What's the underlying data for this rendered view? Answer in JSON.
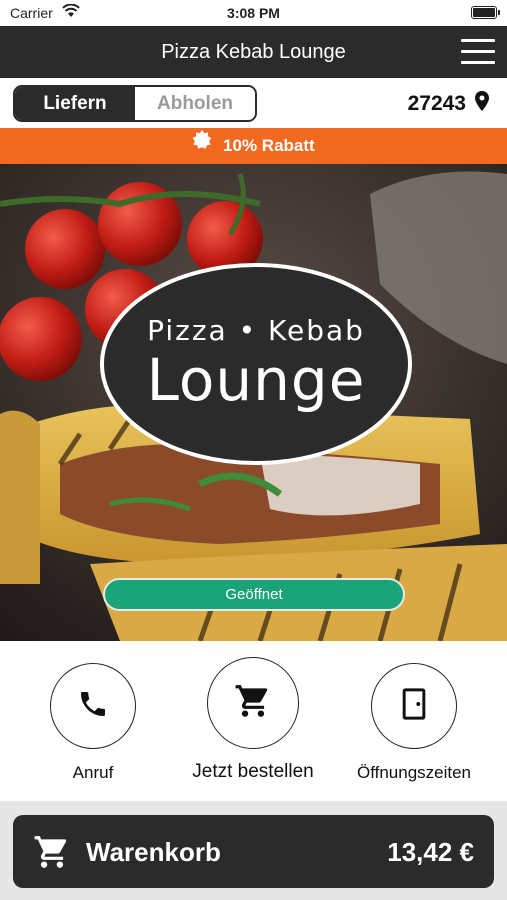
{
  "status_bar": {
    "carrier": "Carrier",
    "time": "3:08 PM"
  },
  "header": {
    "title": "Pizza Kebab Lounge"
  },
  "mode": {
    "delivery": "Liefern",
    "pickup": "Abholen",
    "selected": "Liefern",
    "zip": "27243"
  },
  "promo": {
    "text": "10% Rabatt"
  },
  "hero": {
    "logo_top": "Pizza • Kebab",
    "logo_main": "Lounge",
    "status_button": "Geöffnet"
  },
  "actions": [
    {
      "label": "Anruf",
      "icon": "phone-icon"
    },
    {
      "label": "Jetzt bestellen",
      "icon": "cart-icon"
    },
    {
      "label": "Öffnungszeiten",
      "icon": "door-icon"
    }
  ],
  "cart": {
    "label": "Warenkorb",
    "total": "13,42 €"
  },
  "colors": {
    "dark": "#2b2b2b",
    "accent_orange": "#f26a22",
    "open_green": "#1aa477"
  }
}
